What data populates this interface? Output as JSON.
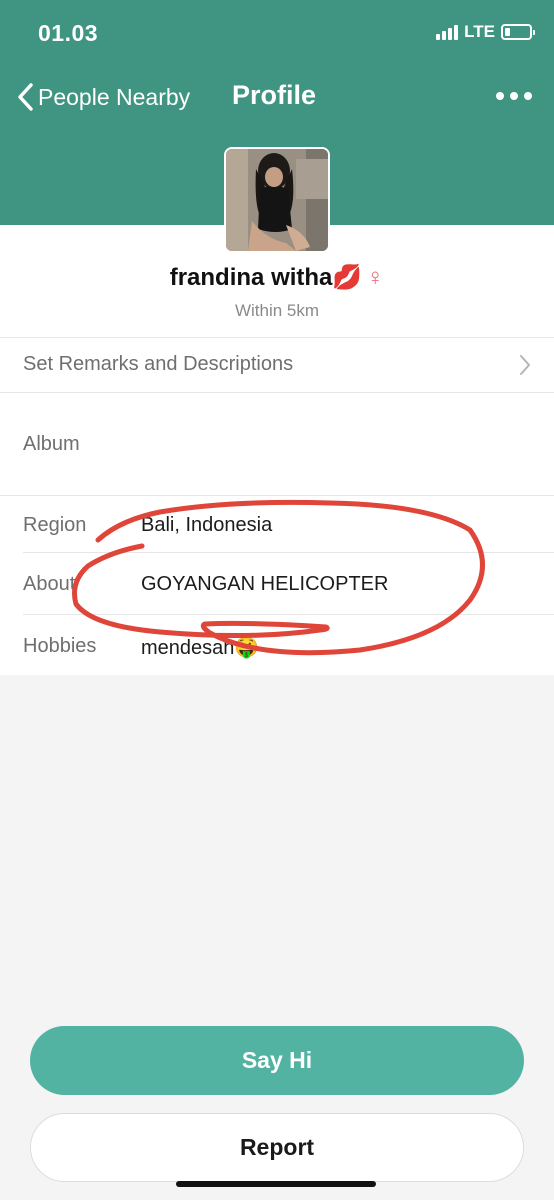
{
  "status_bar": {
    "time": "01.03",
    "network": "LTE"
  },
  "navbar": {
    "back_label": "People Nearby",
    "title": "Profile"
  },
  "profile": {
    "name": "frandina witha💋",
    "gender_symbol": "♀",
    "distance": "Within 5km"
  },
  "rows": {
    "remarks_label": "Set Remarks and Descriptions",
    "album_label": "Album",
    "region_label": "Region",
    "region_value": "Bali, Indonesia",
    "about_label": "About",
    "about_value": "GOYANGAN HELICOPTER",
    "hobbies_label": "Hobbies",
    "hobbies_value": "mendesah🤑"
  },
  "buttons": {
    "say_hi": "Say Hi",
    "report": "Report"
  },
  "colors": {
    "header_bg": "#3f9582",
    "primary_button": "#52b3a2",
    "annotation": "#e0453a",
    "female_symbol": "#e8707a"
  },
  "icons": {
    "back": "chevron-left-icon",
    "more": "more-horizontal-icon",
    "chevron": "chevron-right-icon",
    "signal": "signal-bars-icon",
    "battery": "battery-icon"
  }
}
